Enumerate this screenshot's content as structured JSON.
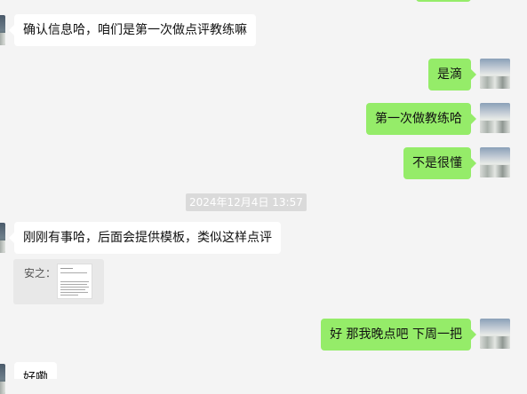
{
  "messages": [
    {
      "side": "left",
      "text": "确认信息哈，咱们是第一次做点评教练嘛"
    },
    {
      "side": "right",
      "text": "是滴"
    },
    {
      "side": "right",
      "text": "第一次做教练哈"
    },
    {
      "side": "right",
      "text": "不是很懂"
    },
    {
      "side": "left",
      "text": "刚刚有事哈，后面会提供模板，类似这样点评"
    },
    {
      "side": "right",
      "text": "好 那我晚点吧  下周一把"
    },
    {
      "side": "left",
      "text": "好嘞"
    }
  ],
  "timestamp": "2024年12月4日 13:57",
  "file_card": {
    "sender_label": "安之："
  },
  "colors": {
    "background": "#f4f4f4",
    "self_bubble": "#95ec69",
    "other_bubble": "#ffffff"
  }
}
